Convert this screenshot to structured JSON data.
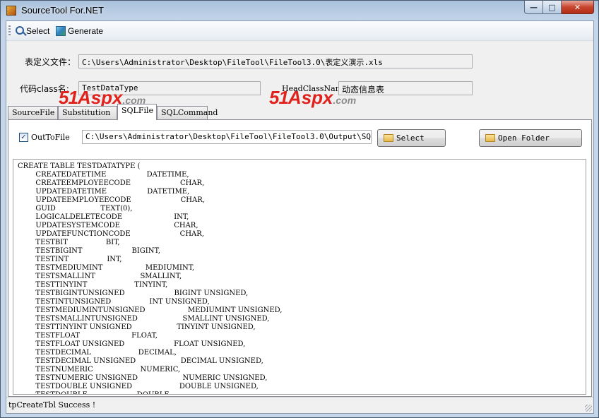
{
  "window": {
    "title": "SourceTool For.NET",
    "buttons": {
      "minimize": "—",
      "maximize": "□",
      "close": "✕"
    }
  },
  "toolbar": {
    "select_label": "Select",
    "generate_label": "Generate"
  },
  "form": {
    "def_file_label": "表定义文件：",
    "def_file_value": "C:\\Users\\Administrator\\Desktop\\FileTool\\FileTool3.0\\表定义演示.xls",
    "class_name_label": "代码class名:",
    "class_name_value": "TestDataType",
    "head_class_label": "HeadClassName",
    "head_class_value": "动态信息表"
  },
  "watermark": {
    "number": "51",
    "brand": "Aspx",
    "domain": ".com"
  },
  "tabs": [
    {
      "label": "SourceFile",
      "active": false
    },
    {
      "label": "Substitution",
      "active": false
    },
    {
      "label": "SQLFile",
      "active": true
    },
    {
      "label": "SQLCommand",
      "active": false
    }
  ],
  "sqlfile": {
    "outtofile_label": "OutToFile",
    "outtofile_checked": true,
    "output_path": "C:\\Users\\Administrator\\Desktop\\FileTool\\FileTool3.0\\Output\\SQL",
    "select_button": "Select",
    "open_folder_button": "Open Folder",
    "sql_text": "CREATE TABLE TESTDATATYPE (\n        CREATEDATETIME                  DATETIME,\n        CREATEEMPLOYEECODE                      CHAR,\n        UPDATEDATETIME                  DATETIME,\n        UPDATEEMPLOYEECODE                      CHAR,\n        GUID                    TEXT(0),\n        LOGICALDELETECODE                       INT,\n        UPDATESYSTEMCODE                        CHAR,\n        UPDATEFUNCTIONCODE                      CHAR,\n        TESTBIT                 BIT,\n        TESTBIGINT                      BIGINT,\n        TESTINT                 INT,\n        TESTMEDIUMINT                   MEDIUMINT,\n        TESTSMALLINT                    SMALLINT,\n        TESTTINYINT                     TINYINT,\n        TESTBIGINTUNSIGNED                      BIGINT UNSIGNED,\n        TESTINTUNSIGNED                 INT UNSIGNED,\n        TESTMEDIUMINTUNSIGNED                   MEDIUMINT UNSIGNED,\n        TESTSMALLINTUNSIGNED                    SMALLINT UNSIGNED,\n        TESTTINYINT UNSIGNED                    TINYINT UNSIGNED,\n        TESTFLOAT                       FLOAT,\n        TESTFLOAT UNSIGNED                      FLOAT UNSIGNED,\n        TESTDECIMAL                     DECIMAL,\n        TESTDECIMAL UNSIGNED                    DECIMAL UNSIGNED,\n        TESTNUMERIC                     NUMERIC,\n        TESTNUMERIC UNSIGNED                    NUMERIC UNSIGNED,\n        TESTDOUBLE UNSIGNED                     DOUBLE UNSIGNED,\n        TESTDOUBLE                      DOUBLE,"
  },
  "status": {
    "text": "tpCreateTbl   Success !"
  }
}
